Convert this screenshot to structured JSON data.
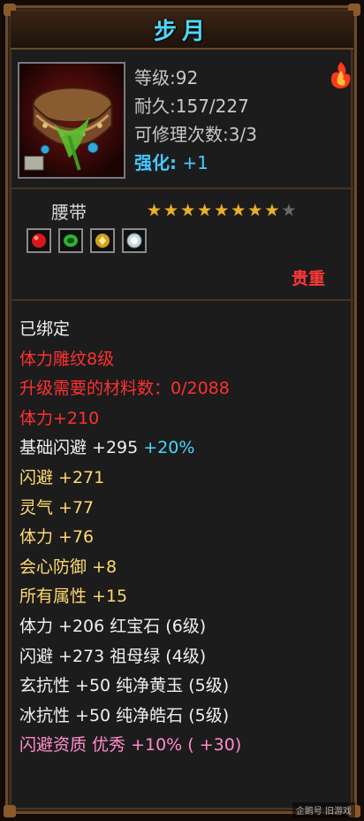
{
  "title": "步月",
  "stats": {
    "level_label": "等级",
    "level_value": ":92",
    "durability_label": "耐久",
    "durability_value": ":157/227",
    "repair_label": "可修理次数",
    "repair_value": ":3/3",
    "enhance_label": "强化:",
    "enhance_value": "+1"
  },
  "item_type": "腰带",
  "stars": {
    "filled": 8,
    "total": 9
  },
  "gems": [
    {
      "icon": "red-gem-icon",
      "color": "#d81818"
    },
    {
      "icon": "green-gem-icon",
      "color": "#30b030"
    },
    {
      "icon": "yellow-gem-icon",
      "color": "#d0a020"
    },
    {
      "icon": "white-gem-icon",
      "color": "#c8d8e0"
    }
  ],
  "quality": "贵重",
  "properties": {
    "bound": "已绑定",
    "carving": "体力雕纹8级",
    "material": "升级需要的材料数：0/2088",
    "stamina_bonus": "体力+210",
    "base_dodge": "基础闪避 +295",
    "base_dodge_pct": "+20%",
    "dodge": "闪避 +271",
    "spirit": "灵气 +77",
    "stamina": "体力 +76",
    "crit_defense": "会心防御 +8",
    "all_attr": "所有属性 +15",
    "gem_stamina": "体力 +206 红宝石 (6级)",
    "gem_dodge": "闪避 +273 祖母绿 (4级)",
    "dark_res": "玄抗性 +50 纯净黄玉 (5级)",
    "ice_res": "冰抗性 +50 纯净皓石 (5级)",
    "dodge_quality": "闪避资质  优秀  +10% ( +30)"
  },
  "colors": {
    "title": "#4fd8ff",
    "white": "#f0f0f0",
    "red": "#ff3030",
    "yellow": "#ffd870",
    "pink": "#ff8ccc",
    "cyan": "#46d8ff",
    "border": "#6b4a2a"
  },
  "watermark": "企鹅号 旧游戏"
}
